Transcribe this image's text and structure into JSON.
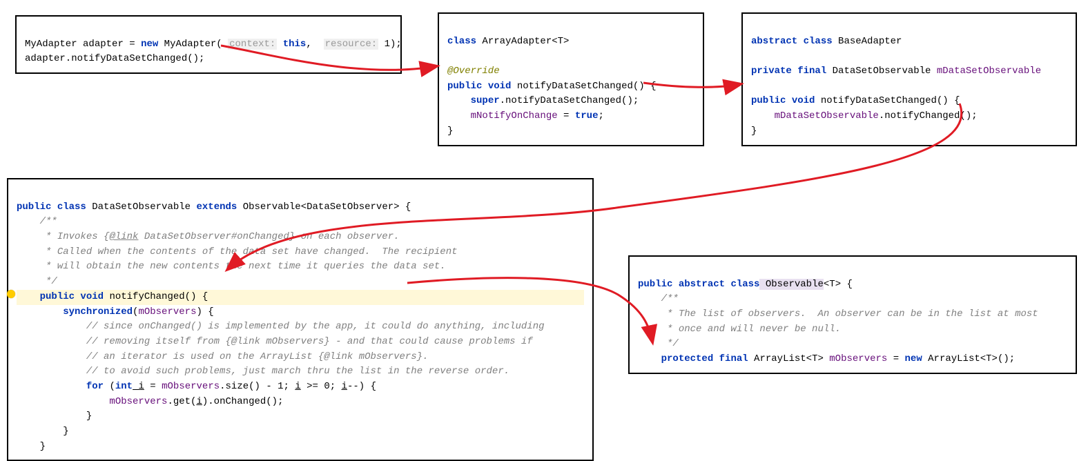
{
  "box1": {
    "l1_type": "MyAdapter",
    "l1_var": "adapter",
    "l1_eq": " = ",
    "l1_new": "new",
    "l1_ctor": " MyAdapter( ",
    "l1_hint1": "context:",
    "l1_this": " this",
    "l1_comma": ",  ",
    "l1_hint2": "resource:",
    "l1_num": " 1",
    "l1_end": ");",
    "l2": "adapter.notifyDataSetChanged();"
  },
  "box2": {
    "l1_class": "class",
    "l1_name": " ArrayAdapter<T>",
    "l2_anno": "@Override",
    "l3_public": "public",
    "l3_void": " void",
    "l3_rest": " notifyDataSetChanged() {",
    "l4_super": "super",
    "l4_rest": ".notifyDataSetChanged();",
    "l5_field": "mNotifyOnChange",
    "l5_eq": " = ",
    "l5_true": "true",
    "l5_semi": ";",
    "l6": "}"
  },
  "box3": {
    "l1_abstract": "abstract",
    "l1_class": " class",
    "l1_name": " BaseAdapter",
    "l2_private": "private",
    "l2_final": " final",
    "l2_type": " DataSetObservable ",
    "l2_field": "mDataSetObservable",
    "l3_public": "public",
    "l3_void": " void",
    "l3_rest": " notifyDataSetChanged() {",
    "l4_field": "mDataSetObservable",
    "l4_rest": ".notifyChanged();",
    "l5": "}"
  },
  "box4": {
    "l1_public": "public",
    "l1_class": " class",
    "l1_name": " DataSetObservable ",
    "l1_extends": "extends",
    "l1_super": " Observable<DataSetObserver> {",
    "c1": "/**",
    "c2a": " * Invokes {",
    "c2_link": "@link",
    "c2b": " DataSetObserver#onChanged} on each observer.",
    "c3": " * Called when the contents of the data set have changed.  The recipient",
    "c4": " * will obtain the new contents the next time it queries the data set.",
    "c5": " */",
    "m1_public": "public",
    "m1_void": " void",
    "m1_rest": " notifyChanged() {",
    "m2_sync": "synchronized",
    "m2_open": "(",
    "m2_field": "mObservers",
    "m2_close": ") {",
    "cc1": "// since onChanged() is implemented by the app, it could do anything, including",
    "cc2": "// removing itself from {@link mObservers} - and that could cause problems if",
    "cc3": "// an iterator is used on the ArrayList {@link mObservers}.",
    "cc4": "// to avoid such problems, just march thru the list in the reverse order.",
    "f1_for": "for",
    "f1_open": " (",
    "f1_int": "int",
    "f1_i1": " i",
    "f1_eq": " = ",
    "f1_mobs": "mObservers",
    "f1_rest1": ".size() - 1; ",
    "f1_i2": "i",
    "f1_cond": " >= 0; ",
    "f1_i3": "i",
    "f1_dec": "--) {",
    "body_field": "mObservers",
    "body_get": ".get(",
    "body_i": "i",
    "body_rest": ").onChanged();",
    "close1": "}",
    "close2": "}",
    "close3": "}"
  },
  "box5": {
    "l1_public": "public",
    "l1_abstract": " abstract",
    "l1_class": " class",
    "l1_name": " Observable",
    "l1_gen": "<T> {",
    "c1": "/**",
    "c2": " * The list of observers.  An observer can be in the list at most",
    "c3": " * once and will never be null.",
    "c4": " */",
    "f_protected": "protected",
    "f_final": " final",
    "f_type": " ArrayList<T> ",
    "f_name": "mObservers",
    "f_eq": " = ",
    "f_new": "new",
    "f_rest": " ArrayList<T>();"
  }
}
